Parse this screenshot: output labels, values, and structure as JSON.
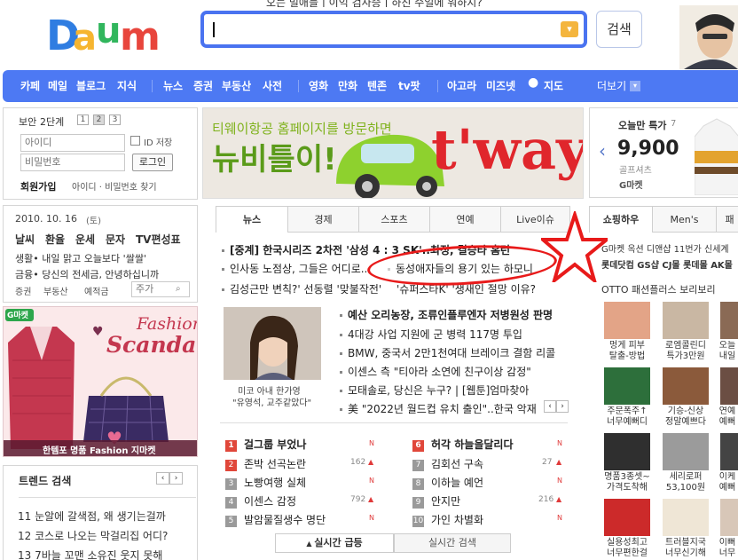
{
  "header": {
    "logo_text": "Daum",
    "top_notice": "오는 밀애들 | 이익 검사증 | 하진 수일에 워하지?",
    "search_value": "",
    "search_button": "검색",
    "drop_icon": "chevron-down-icon"
  },
  "nav": {
    "items": [
      "카페",
      "메일",
      "블로그",
      "지식",
      "뉴스",
      "증권",
      "부동산",
      "사전",
      "영화",
      "만화",
      "텐존",
      "tv팟",
      "아고라",
      "미즈넷",
      "지도"
    ],
    "more": "더보기"
  },
  "login": {
    "security_label": "보안",
    "security_level": "2단계",
    "levels": [
      "1",
      "2",
      "3"
    ],
    "id_placeholder": "아이디",
    "pw_placeholder": "비밀번호",
    "save_id": "ID 저장",
    "login_button": "로그인",
    "join": "회원가입",
    "find": "아이디 · 비밀번호 찾기"
  },
  "today": {
    "date": "2010. 10. 16",
    "weekday": "(토)",
    "links": [
      "날씨",
      "환율",
      "운세",
      "문자",
      "TV편성표"
    ],
    "lines": [
      "생활• 내일 맑고 오늘보다 '쌀쌀'",
      "금융• 당신의 전세금, 안녕하십니까"
    ],
    "stock_tabs": [
      "증권",
      "부동산",
      "예적금"
    ],
    "stock_placeholder": "주가"
  },
  "ad_left": {
    "title1": "Fashion",
    "title2": "Scandal",
    "footer": "한템포 명품 Fashion 지마켓",
    "badge": "G마켓"
  },
  "trend": {
    "title": "트렌드 검색",
    "items": [
      "11 눈알에 갈색점, 왜 생기는걸까",
      "12 코스로 나오는 막걸리집 어디?",
      "13 7바늘 꼬맨 소유진 웃지 못해"
    ]
  },
  "banner": {
    "line1": "티웨이항공 홈페이지를 방문하면",
    "line2": "뉴비틀이!",
    "brand": "t'way"
  },
  "news": {
    "tabs": [
      "뉴스",
      "경제",
      "스포츠",
      "연예",
      "Live이슈"
    ],
    "headlines": [
      "[중계] 한국시리즈 2차전 '삼성 4 : 3 SK'..최정, 결승타 홈런",
      "인사동 노점상, 그들은 어디로..",
      "동성애자들의 용기 있는 하모니",
      "김성근만 변칙?' 선동렬 '맞불작전'",
      "'슈퍼스타K' '생새인 절망 이유?"
    ],
    "photo_caption_1": "미코 아내 한가영",
    "photo_caption_2": "\"유영석, 교주같았다\"",
    "list": [
      "예산 오리농장, 조류인플루엔자 저병원성 판명",
      "4대강 사업 지원에 군 병력 117명 투입",
      "BMW, 중국서 2만1천여대 브레이크 결함 리콜",
      "이센스 측 \"티아라 소연에 친구이상 감정\"",
      "모태솔로, 당신은 누구? | [웹툰]엄마찾아",
      "美 \"2022년 월드컵 유치 출인\"..한국 악재"
    ]
  },
  "ranking": {
    "left": [
      {
        "num": "1",
        "text": "걸그룹 부었나",
        "cnt": ""
      },
      {
        "num": "2",
        "text": "존박 선곡논란",
        "cnt": "162"
      },
      {
        "num": "3",
        "text": "노빵여행 실체",
        "cnt": ""
      },
      {
        "num": "4",
        "text": "이센스 감정",
        "cnt": "792"
      },
      {
        "num": "5",
        "text": "발암물질생수 명단",
        "cnt": ""
      }
    ],
    "right": [
      {
        "num": "6",
        "text": "허각 하늘을달리다",
        "cnt": ""
      },
      {
        "num": "7",
        "text": "김회선 구속",
        "cnt": "27"
      },
      {
        "num": "8",
        "text": "이하늘 예언",
        "cnt": ""
      },
      {
        "num": "9",
        "text": "안지만",
        "cnt": "216"
      },
      {
        "num": "10",
        "text": "가인 차별화",
        "cnt": ""
      }
    ],
    "tab_active": "실시간 급등",
    "tab_other": "실시간 검색"
  },
  "shop": {
    "today_label": "오늘만 특가",
    "today_count": "7",
    "price": "9,900",
    "item": "골프셔츠",
    "seller": "G마켓",
    "tabs": [
      "쇼핑하우",
      "Men's",
      "패"
    ],
    "promo1": "G마켓 옥션 디앤샵 11번가 신세계",
    "promo2": "롯데닷컴 GS샵 CJ몰 롯데몰 AK몰",
    "otto": "OTTO 패션플러스 보리보리",
    "captions": [
      [
        "멍게 피부",
        "탈출-방법"
      ],
      [
        "로엠콜린디",
        "특가3만원"
      ],
      [
        "오늘",
        "내일"
      ],
      [
        "주문폭주↑",
        "너무예뻐디"
      ],
      [
        "기승-신상",
        "정말예쁘다"
      ],
      [
        "연예",
        "예뻐"
      ],
      [
        "명품3종셋~",
        "가격도착해"
      ],
      [
        "세리로퍼",
        "53,100원"
      ],
      [
        "이케",
        "예뻐"
      ],
      [
        "실용성최고",
        "너무편한걸"
      ],
      [
        "트러블지국",
        "너무신기해"
      ],
      [
        "이뻐",
        "너무"
      ]
    ]
  },
  "colors": {
    "nav_blue": "#4d79f3",
    "search_border": "#4a73f0",
    "rank_red": "#e0473a",
    "rank_gray": "#9a9a9a",
    "annotation_red": "#e81a1a"
  }
}
